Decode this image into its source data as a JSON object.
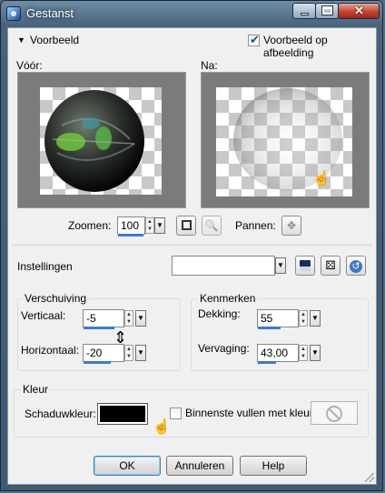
{
  "window": {
    "title": "Gestanst"
  },
  "preview_section": {
    "title": "Voorbeeld",
    "on_image_label": "Voorbeeld op afbeelding",
    "on_image_checked": true,
    "before_label": "Vóór:",
    "after_label": "Na:",
    "zoom_label": "Zoomen:",
    "zoom_value": "100",
    "pan_label": "Pannen:"
  },
  "settings": {
    "label": "Instellingen",
    "value": ""
  },
  "offset": {
    "title": "Verschuiving",
    "vertical_label": "Verticaal:",
    "vertical_value": "-5",
    "horizontal_label": "Horizontaal:",
    "horizontal_value": "-20"
  },
  "attributes": {
    "title": "Kenmerken",
    "opacity_label": "Dekking:",
    "opacity_value": "55",
    "blur_label": "Vervaging:",
    "blur_value": "43,00"
  },
  "color": {
    "title": "Kleur",
    "shadow_label": "Schaduwkleur:",
    "shadow_color": "#000000",
    "fill_inside_label": "Binnenste vullen met kleur:",
    "fill_inside_checked": false
  },
  "buttons": {
    "ok": "OK",
    "cancel": "Annuleren",
    "help": "Help"
  }
}
